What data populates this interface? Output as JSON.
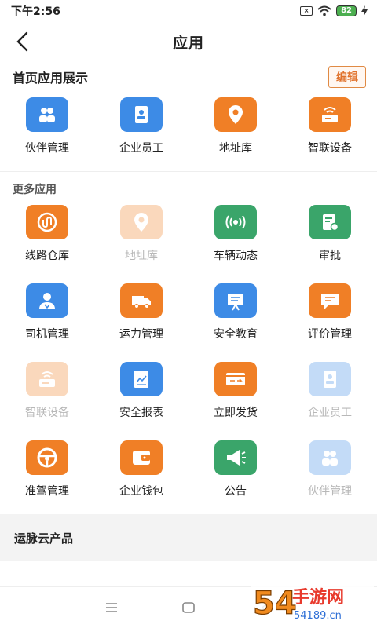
{
  "status": {
    "time": "下午2:56",
    "battery": "82"
  },
  "nav": {
    "title": "应用"
  },
  "home_section": {
    "title": "首页应用展示",
    "edit_label": "编辑"
  },
  "home_apps": [
    {
      "label": "伙伴管理",
      "color": "#3d8be6",
      "icon": "partners-icon",
      "disabled": false
    },
    {
      "label": "企业员工",
      "color": "#3d8be6",
      "icon": "employee-badge-icon",
      "disabled": false
    },
    {
      "label": "地址库",
      "color": "#f07f26",
      "icon": "location-pin-icon",
      "disabled": false
    },
    {
      "label": "智联设备",
      "color": "#f07f26",
      "icon": "router-icon",
      "disabled": false
    }
  ],
  "more_section": {
    "title": "更多应用"
  },
  "more_apps": [
    {
      "label": "线路仓库",
      "color": "#f07f26",
      "icon": "route-icon",
      "disabled": false
    },
    {
      "label": "地址库",
      "color": "#f07f26",
      "icon": "location-pin-icon",
      "disabled": true
    },
    {
      "label": "车辆动态",
      "color": "#3aa56a",
      "icon": "signal-icon",
      "disabled": false
    },
    {
      "label": "审批",
      "color": "#3aa56a",
      "icon": "approval-icon",
      "disabled": false
    },
    {
      "label": "司机管理",
      "color": "#3d8be6",
      "icon": "driver-icon",
      "disabled": false
    },
    {
      "label": "运力管理",
      "color": "#f07f26",
      "icon": "truck-icon",
      "disabled": false
    },
    {
      "label": "安全教育",
      "color": "#3d8be6",
      "icon": "presentation-icon",
      "disabled": false
    },
    {
      "label": "评价管理",
      "color": "#f07f26",
      "icon": "comment-icon",
      "disabled": false
    },
    {
      "label": "智联设备",
      "color": "#f07f26",
      "icon": "router-icon",
      "disabled": true
    },
    {
      "label": "安全报表",
      "color": "#3d8be6",
      "icon": "report-chart-icon",
      "disabled": false
    },
    {
      "label": "立即发货",
      "color": "#f07f26",
      "icon": "ship-card-icon",
      "disabled": false
    },
    {
      "label": "企业员工",
      "color": "#3d8be6",
      "icon": "employee-badge-icon",
      "disabled": true
    },
    {
      "label": "准驾管理",
      "color": "#f07f26",
      "icon": "steering-wheel-icon",
      "disabled": false
    },
    {
      "label": "企业钱包",
      "color": "#f07f26",
      "icon": "wallet-icon",
      "disabled": false
    },
    {
      "label": "公告",
      "color": "#3aa56a",
      "icon": "megaphone-icon",
      "disabled": false
    },
    {
      "label": "伙伴管理",
      "color": "#3d8be6",
      "icon": "partners-icon",
      "disabled": true
    }
  ],
  "products": {
    "title": "运脉云产品"
  },
  "watermark": {
    "text": "54189手游网",
    "url_text": "www.54189.cn"
  }
}
